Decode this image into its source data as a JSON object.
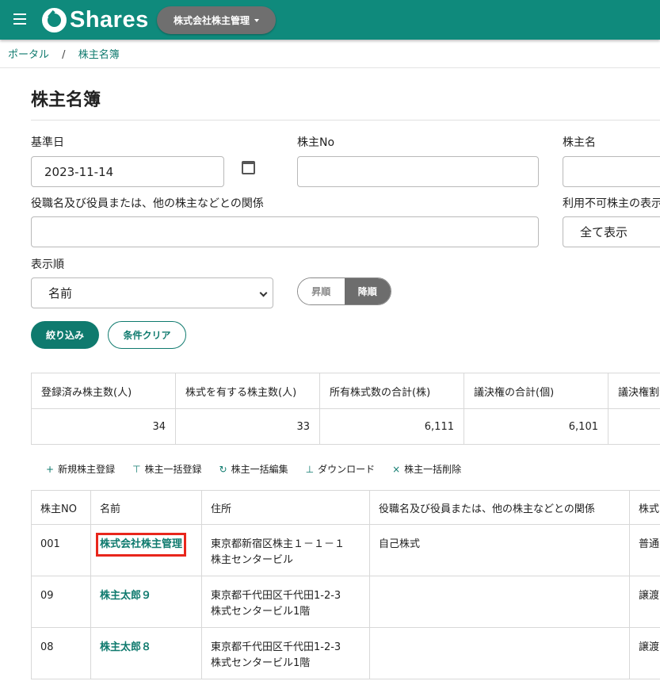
{
  "header": {
    "logo_text": "Shares",
    "company_button": "株式会社株主管理"
  },
  "breadcrumb": {
    "home": "ポータル",
    "separator": "/",
    "current": "株主名簿"
  },
  "page": {
    "title": "株主名簿"
  },
  "filters": {
    "base_date_label": "基準日",
    "base_date_value": "2023-11-14",
    "shareholder_no_label": "株主No",
    "shareholder_no_value": "",
    "shareholder_name_label": "株主名",
    "relation_label": "役職名及び役員または、他の株主などとの関係",
    "relation_value": "",
    "unusable_label": "利用不可株主の表示",
    "unusable_value": "全て表示",
    "sort_label": "表示順",
    "sort_value": "名前",
    "order_asc": "昇順",
    "order_desc": "降順",
    "filter_button": "絞り込み",
    "clear_button": "条件クリア"
  },
  "summary": {
    "headers": [
      "登録済み株主数(人)",
      "株式を有する株主数(人)",
      "所有株式数の合計(株)",
      "議決権の合計(個)",
      "議決権割合"
    ],
    "values": [
      "34",
      "33",
      "6,111",
      "6,101",
      ""
    ]
  },
  "actions": {
    "new": "新規株主登録",
    "bulk_register": "株主一括登録",
    "bulk_edit": "株主一括編集",
    "download": "ダウンロード",
    "bulk_delete": "株主一括削除"
  },
  "table": {
    "headers": [
      "株主NO",
      "名前",
      "住所",
      "役職名及び役員または、他の株主などとの関係",
      "株式"
    ],
    "rows": [
      {
        "no": "001",
        "name": "株式会社株主管理",
        "address1": "東京都新宿区株主１－１－１",
        "address2": "株主センタービル",
        "relation": "自己株式",
        "kind": "普通"
      },
      {
        "no": "09",
        "name": "株主太郎９",
        "address1": "東京都千代田区千代田1-2-3",
        "address2": "株式センタービル1階",
        "relation": "",
        "kind": "譲渡"
      },
      {
        "no": "08",
        "name": "株主太郎８",
        "address1": "東京都千代田区千代田1-2-3",
        "address2": "株式センタービル1階",
        "relation": "",
        "kind": "譲渡"
      }
    ]
  }
}
